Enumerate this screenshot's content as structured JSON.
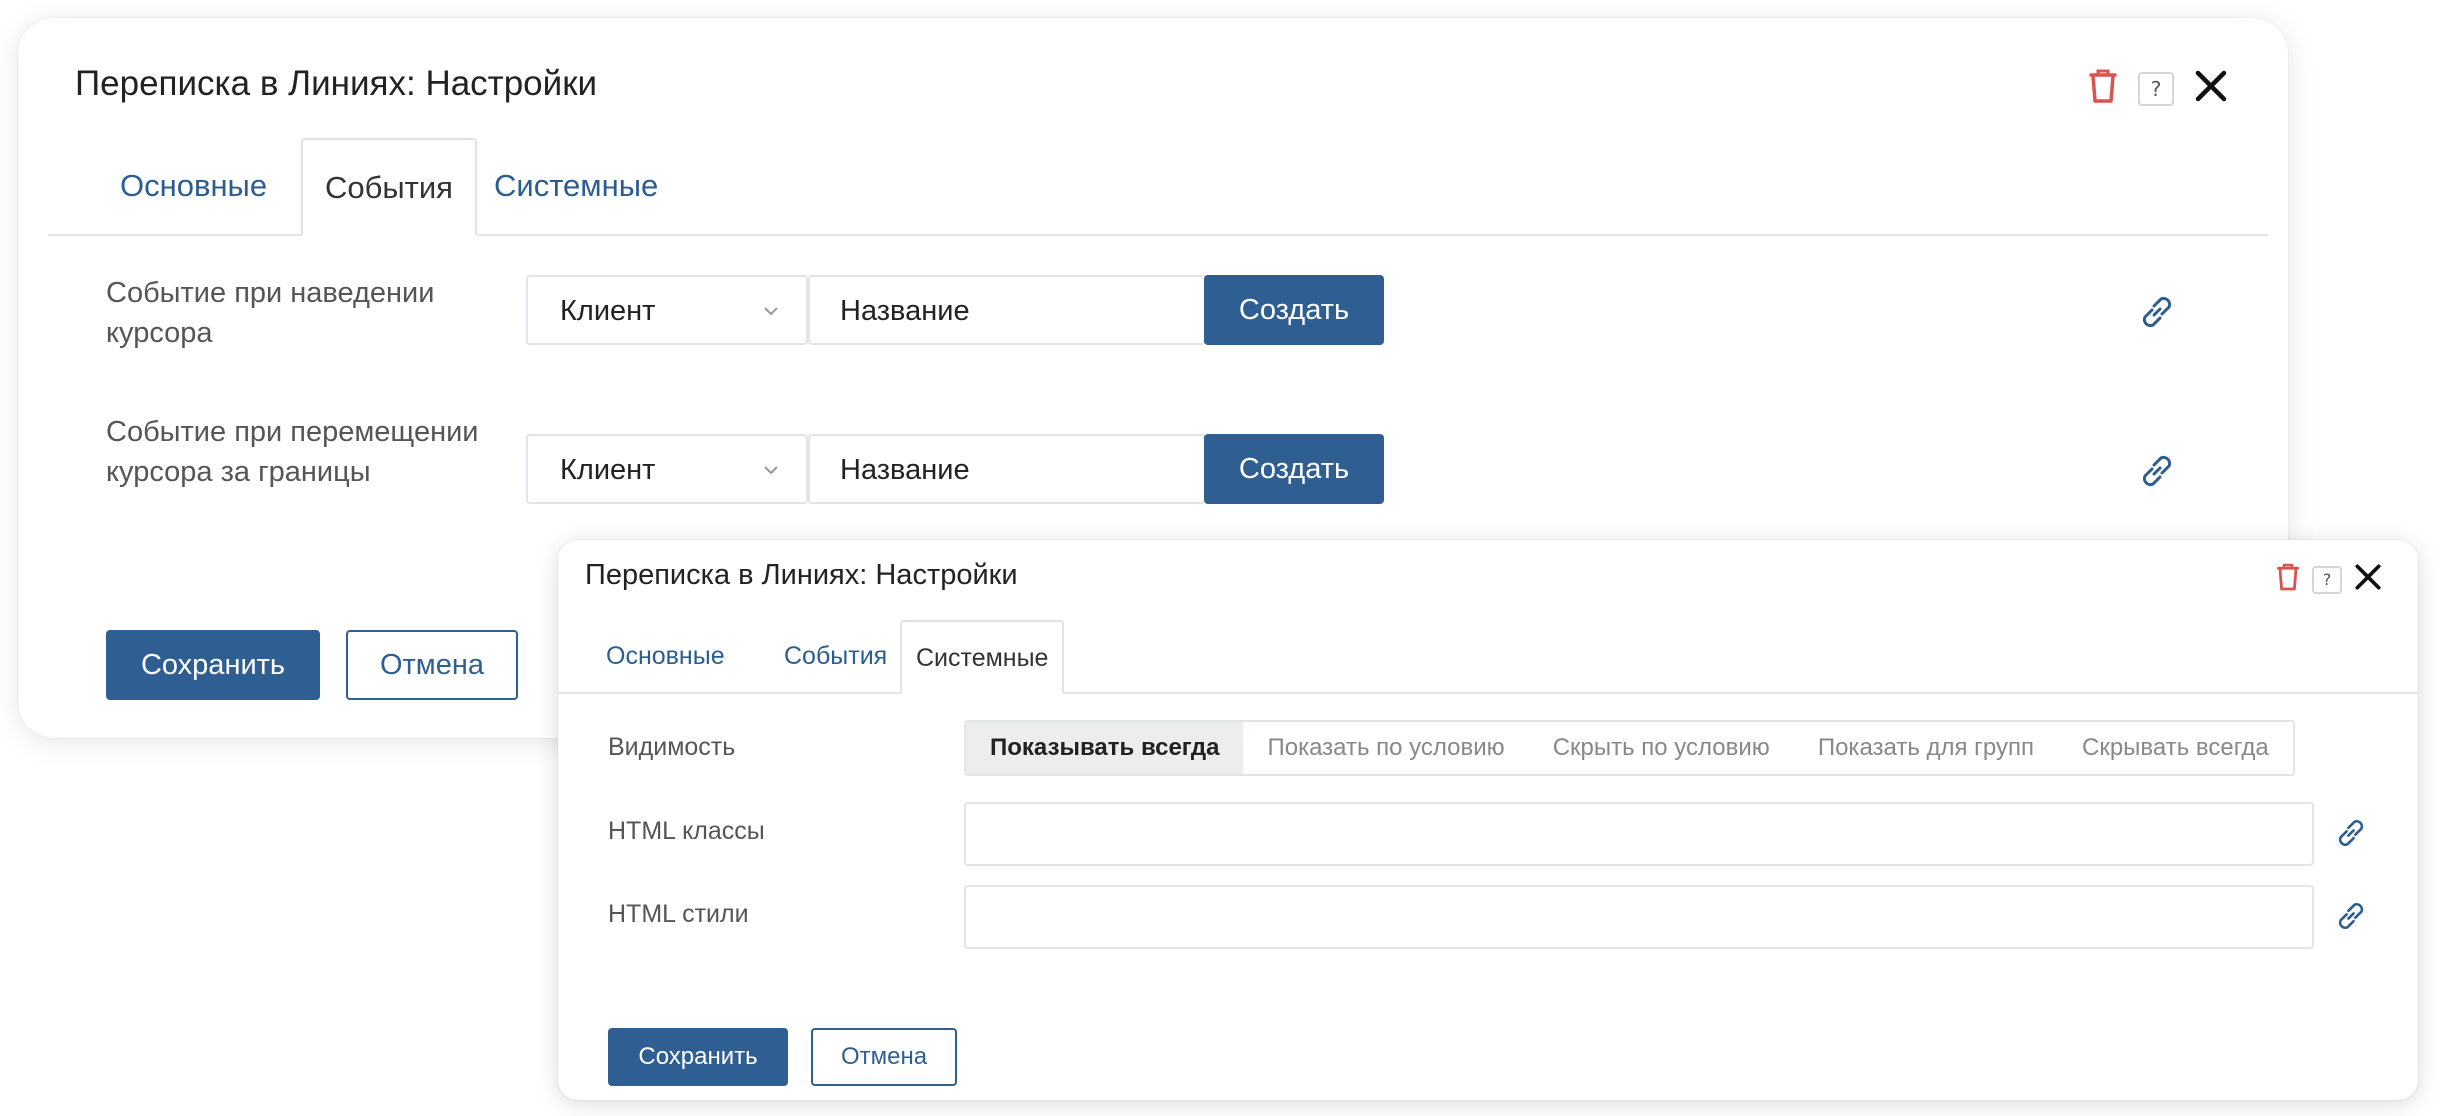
{
  "back_dialog": {
    "title": "Переписка в Линиях: Настройки",
    "tabs": [
      {
        "label": "Основные",
        "active": false
      },
      {
        "label": "События",
        "active": true
      },
      {
        "label": "Системные",
        "active": false
      }
    ],
    "rows": [
      {
        "label": "Событие при наведении курсора",
        "select_value": "Клиент",
        "name_placeholder": "Название",
        "create_label": "Создать"
      },
      {
        "label": "Событие при перемещении курсора за границы",
        "select_value": "Клиент",
        "name_placeholder": "Название",
        "create_label": "Создать"
      }
    ],
    "save_label": "Сохранить",
    "cancel_label": "Отмена"
  },
  "front_dialog": {
    "title": "Переписка в Линиях: Настройки",
    "tabs": [
      {
        "label": "Основные",
        "active": false
      },
      {
        "label": "События",
        "active": false
      },
      {
        "label": "Системные",
        "active": true
      }
    ],
    "visibility": {
      "label": "Видимость",
      "options": [
        "Показывать всегда",
        "Показать по условию",
        "Скрыть по условию",
        "Показать для групп",
        "Скрывать всегда"
      ],
      "selected": "Показывать всегда"
    },
    "html_classes": {
      "label": "HTML классы",
      "value": ""
    },
    "html_styles": {
      "label": "HTML стили",
      "value": ""
    },
    "save_label": "Сохранить",
    "cancel_label": "Отмена"
  },
  "colors": {
    "accent": "#2f5f92",
    "link": "#2b5d92",
    "delete": "#d9534f"
  },
  "icons": {
    "delete": "trash-icon",
    "help": "help-icon",
    "close": "close-icon",
    "link": "link-icon",
    "dropdown": "chevron-down-icon"
  }
}
